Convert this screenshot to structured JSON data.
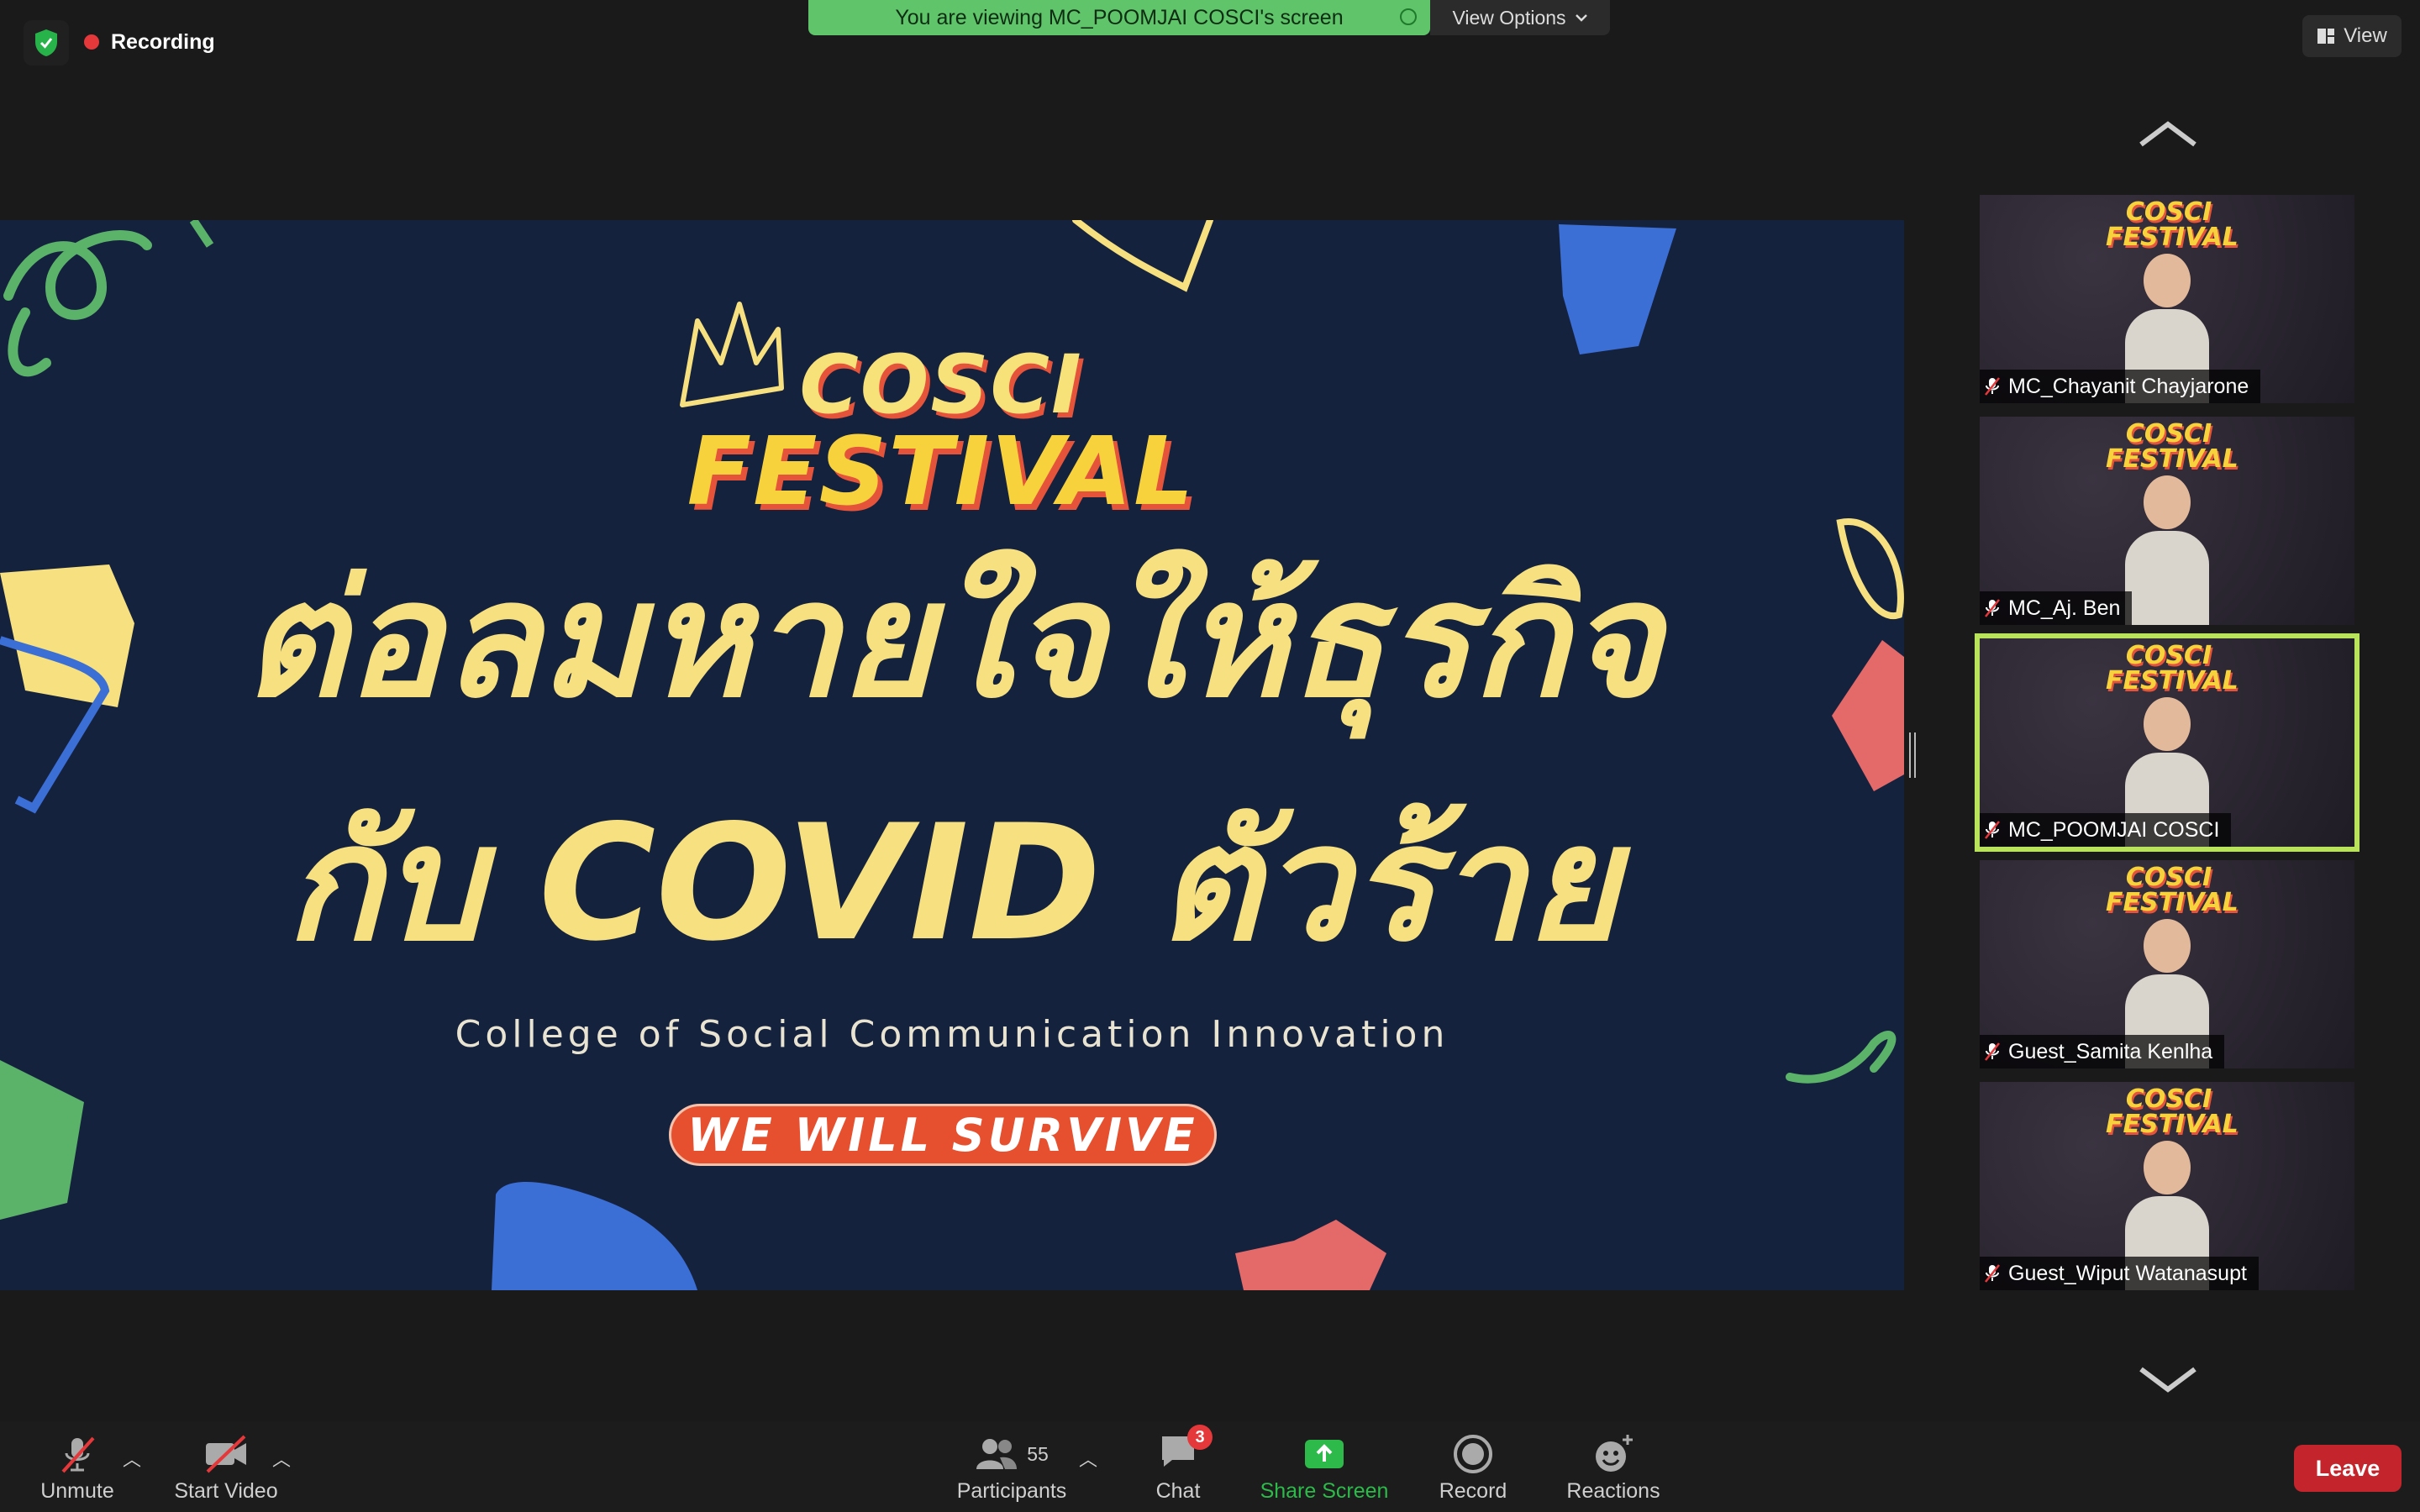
{
  "top_bar": {
    "recording_label": "Recording",
    "viewing_banner": "You are viewing MC_POOMJAI COSCI's screen",
    "view_options_label": "View Options",
    "view_label": "View"
  },
  "slide": {
    "title_line1": "COSCI",
    "title_line2": "FESTIVAL",
    "headline_line1": "ต่อลมหายใจให้ธุรกิจ",
    "headline_line2": "กับ COVID ตัวร้าย",
    "subtitle": "College of Social Communication Innovation",
    "tagline": "WE WILL SURVIVE"
  },
  "participants_gallery": [
    {
      "name": "MC_Chayanit Chayjarone",
      "active": false
    },
    {
      "name": "MC_Aj. Ben",
      "active": false
    },
    {
      "name": "MC_POOMJAI COSCI",
      "active": true
    },
    {
      "name": "Guest_Samita Kenlha",
      "active": false
    },
    {
      "name": "Guest_Wiput Watanasupt",
      "active": false
    }
  ],
  "toolbar": {
    "unmute_label": "Unmute",
    "start_video_label": "Start Video",
    "participants_label": "Participants",
    "participants_count": "55",
    "chat_label": "Chat",
    "chat_badge": "3",
    "share_screen_label": "Share Screen",
    "record_label": "Record",
    "reactions_label": "Reactions",
    "leave_label": "Leave"
  },
  "colors": {
    "viewing_banner_bg": "#5fc46a",
    "share_screen_green": "#2dba4a",
    "leave_red": "#c4242b",
    "active_speaker_outline": "#b9e35a",
    "slide_bg": "#15223e"
  }
}
